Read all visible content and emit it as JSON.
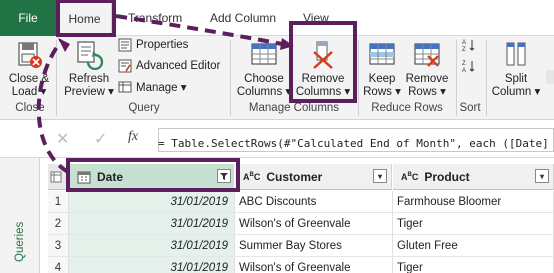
{
  "tabs": {
    "file": "File",
    "home": "Home",
    "transform": "Transform",
    "add_column": "Add Column",
    "view": "View"
  },
  "ribbon": {
    "close_load": [
      "Close &",
      "Load ▾"
    ],
    "refresh_preview": [
      "Refresh",
      "Preview ▾"
    ],
    "properties": "Properties",
    "advanced_editor": "Advanced Editor",
    "manage": "Manage ▾",
    "choose_columns": [
      "Choose",
      "Columns ▾"
    ],
    "remove_columns": [
      "Remove",
      "Columns ▾"
    ],
    "keep_rows": [
      "Keep",
      "Rows ▾"
    ],
    "remove_rows": [
      "Remove",
      "Rows ▾"
    ],
    "split_column": [
      "Split",
      "Column ▾"
    ],
    "groups": {
      "close": "Close",
      "query": "Query",
      "manage_columns": "Manage Columns",
      "reduce_rows": "Reduce Rows",
      "sort": "Sort"
    }
  },
  "formula_bar": {
    "fx": "fx",
    "formula": "= Table.SelectRows(#\"Calculated End of Month\", each ([Date]"
  },
  "queries_panel": {
    "label": "Queries"
  },
  "table": {
    "columns": [
      {
        "name": "Date",
        "type": "date"
      },
      {
        "name": "Customer",
        "type": "ABC"
      },
      {
        "name": "Product",
        "type": "ABC"
      }
    ],
    "rows": [
      {
        "num": "1",
        "date": "31/01/2019",
        "customer": "ABC Discounts",
        "product": "Farmhouse Bloomer"
      },
      {
        "num": "2",
        "date": "31/01/2019",
        "customer": "Wilson's of Greenvale",
        "product": "Tiger"
      },
      {
        "num": "3",
        "date": "31/01/2019",
        "customer": "Summer Bay Stores",
        "product": "Gluten Free"
      },
      {
        "num": "4",
        "date": "31/01/2019",
        "customer": "Wilson's of Greenvale",
        "product": "Tiger"
      }
    ]
  },
  "colors": {
    "file_tab": "#217346",
    "highlight": "#5b1f5e",
    "date_header": "#c6e0d1",
    "date_cells": "#e4f1ea"
  }
}
